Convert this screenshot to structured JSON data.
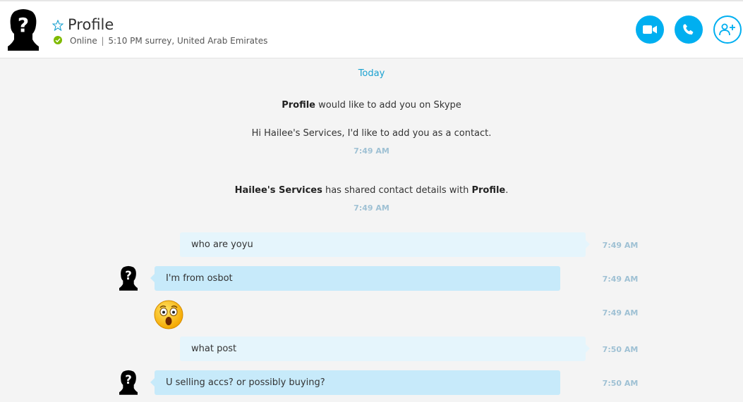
{
  "header": {
    "contact_name": "Profile",
    "status": "Online",
    "location": "5:10 PM surrey, United Arab Emirates",
    "separator": "|",
    "buttons": {
      "video": "video-call-icon",
      "call": "phone-icon",
      "add": "add-contact-icon"
    }
  },
  "conversation": {
    "date_separator": "Today",
    "system_messages": [
      {
        "bold_name": "Profile",
        "text": " would like to add you on Skype"
      },
      {
        "text": "Hi Hailee's Services, I'd like to add you as a contact.",
        "time": "7:49 AM"
      },
      {
        "bold_name": "Hailee's Services",
        "text_middle": " has shared contact details with ",
        "bold_target": "Profile",
        "text_end": ".",
        "time": "7:49 AM"
      }
    ],
    "messages": [
      {
        "direction": "out",
        "text": "who are yoyu",
        "time": "7:49 AM"
      },
      {
        "direction": "in",
        "text": "I'm from osbot",
        "time": "7:49 AM"
      },
      {
        "direction": "in",
        "emoji": "surprised-emoji-icon",
        "time": "7:49 AM"
      },
      {
        "direction": "out",
        "text": "what post",
        "time": "7:50 AM"
      },
      {
        "direction": "in",
        "text": "U selling accs? or possibly buying?",
        "time": "7:50 AM"
      }
    ]
  },
  "colors": {
    "accent": "#00aff0",
    "online": "#7fba00",
    "bubble_out": "#e5f5fc",
    "bubble_in": "#c7eafa",
    "time_text": "#9fc1d4"
  }
}
